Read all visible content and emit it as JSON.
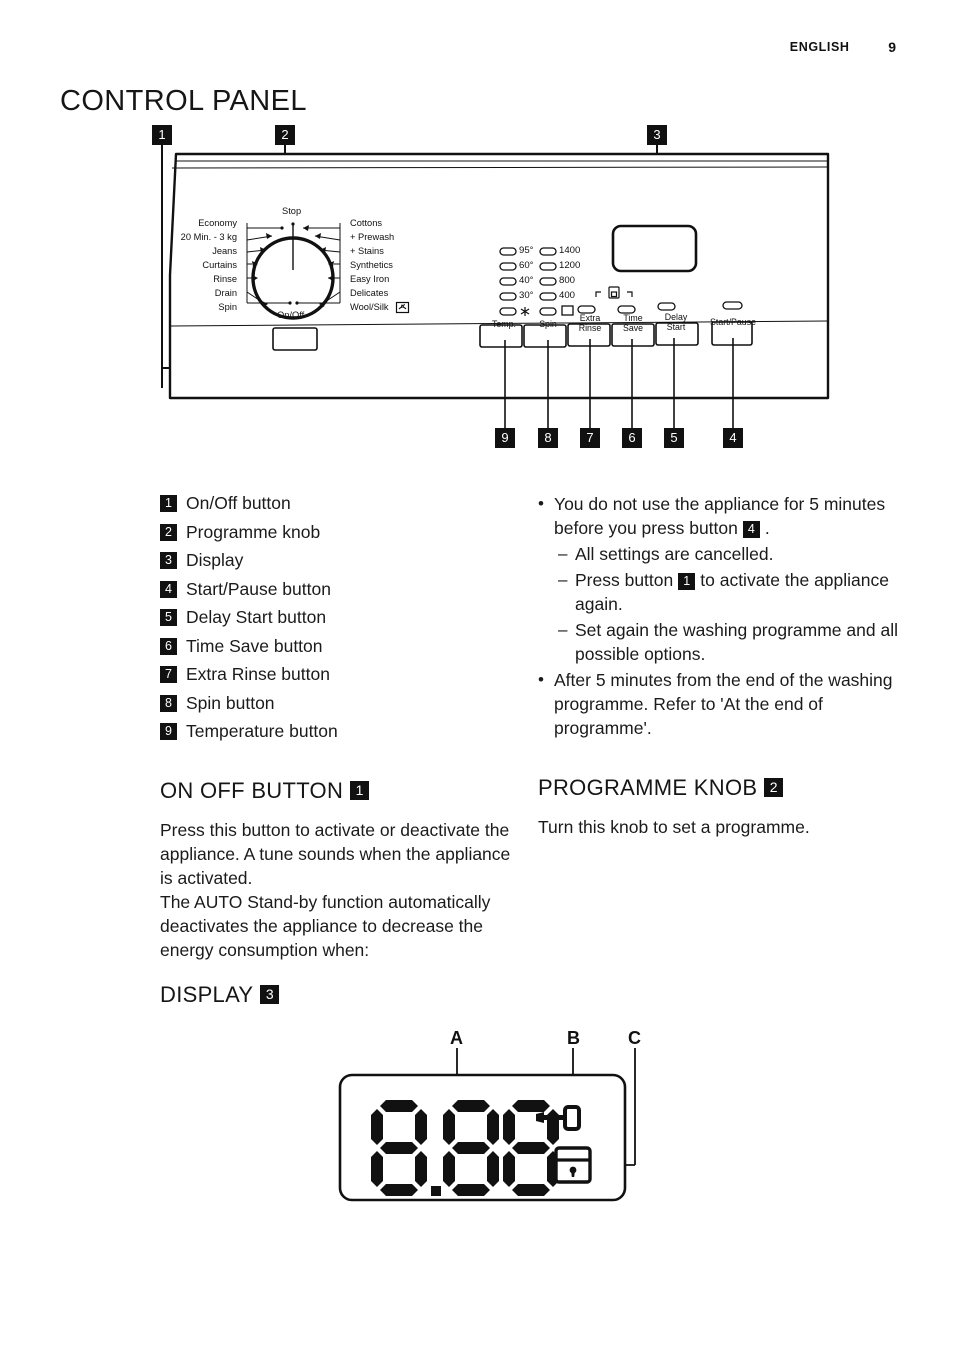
{
  "header": {
    "language": "ENGLISH",
    "page_number": "9"
  },
  "main_title": "CONTROL PANEL",
  "panel_figure": {
    "callouts_top": [
      {
        "num": "1"
      },
      {
        "num": "2"
      },
      {
        "num": "3"
      }
    ],
    "callouts_bottom": [
      {
        "num": "9"
      },
      {
        "num": "8"
      },
      {
        "num": "7"
      },
      {
        "num": "6"
      },
      {
        "num": "5"
      },
      {
        "num": "4"
      }
    ],
    "knob": {
      "top_label": "Stop",
      "bottom_label": "On/Off",
      "left_programmes": [
        "Economy",
        "20 Min. - 3 kg",
        "Jeans",
        "Curtains",
        "Rinse",
        "Drain",
        "Spin"
      ],
      "right_programmes": [
        "Cottons",
        "+ Prewash",
        "+ Stains",
        "Synthetics",
        "Easy Iron",
        "Delicates",
        "Wool/Silk"
      ]
    },
    "indicators": {
      "temperature": [
        "95°",
        "60°",
        "40°",
        "30°",
        "cold-snowflake-icon"
      ],
      "spin": [
        "1400",
        "1200",
        "800",
        "400",
        "no-spin-icon"
      ]
    },
    "button_captions": [
      "Temp.",
      "Spin",
      "Extra\nRinse",
      "Time\nSave",
      "Delay\nStart",
      "Start/Pause"
    ],
    "button_caption_lines": {
      "temp": "Temp.",
      "spin": "Spin",
      "extra_rinse_1": "Extra",
      "extra_rinse_2": "Rinse",
      "time_save_1": "Time",
      "time_save_2": "Save",
      "delay_start_1": "Delay",
      "delay_start_2": "Start",
      "start_pause": "Start/Pause"
    }
  },
  "legend": [
    {
      "num": "1",
      "label": "On/Off button"
    },
    {
      "num": "2",
      "label": "Programme knob"
    },
    {
      "num": "3",
      "label": "Display"
    },
    {
      "num": "4",
      "label": "Start/Pause button"
    },
    {
      "num": "5",
      "label": "Delay Start button"
    },
    {
      "num": "6",
      "label": "Time Save button"
    },
    {
      "num": "7",
      "label": "Extra Rinse button"
    },
    {
      "num": "8",
      "label": "Spin button"
    },
    {
      "num": "9",
      "label": "Temperature button"
    }
  ],
  "right_notes": {
    "bullet1_part1": "You do not use the appliance for 5 minutes before you press button",
    "bullet1_badge": "4",
    "bullet1_part2": ".",
    "sub1": "All settings are cancelled.",
    "sub2_part1": "Press button",
    "sub2_badge": "1",
    "sub2_part2": "to activate the appliance again.",
    "sub3": "Set again the washing programme and all possible options.",
    "bullet2": "After 5 minutes from the end of the washing programme. Refer to 'At the end of programme'."
  },
  "sections": {
    "on_off": {
      "heading": "ON OFF BUTTON",
      "badge": "1",
      "body": "Press this button to activate or deactivate the appliance. A tune sounds when the appliance is activated.\nThe AUTO Stand-by function automatically deactivates the appliance to decrease the energy consumption when:"
    },
    "programme_knob": {
      "heading": "PROGRAMME KNOB",
      "badge": "2",
      "body": "Turn this knob to set a programme."
    },
    "display": {
      "heading": "DISPLAY",
      "badge": "3"
    }
  },
  "display_figure": {
    "callouts": [
      "A",
      "B",
      "C"
    ],
    "digits": "8.88",
    "icons": [
      "key-icon",
      "padlock-icon"
    ]
  },
  "colors": {
    "badge_bg": "#111111",
    "badge_fg": "#ffffff",
    "ink": "#1a1a1a",
    "page_bg": "#ffffff"
  }
}
